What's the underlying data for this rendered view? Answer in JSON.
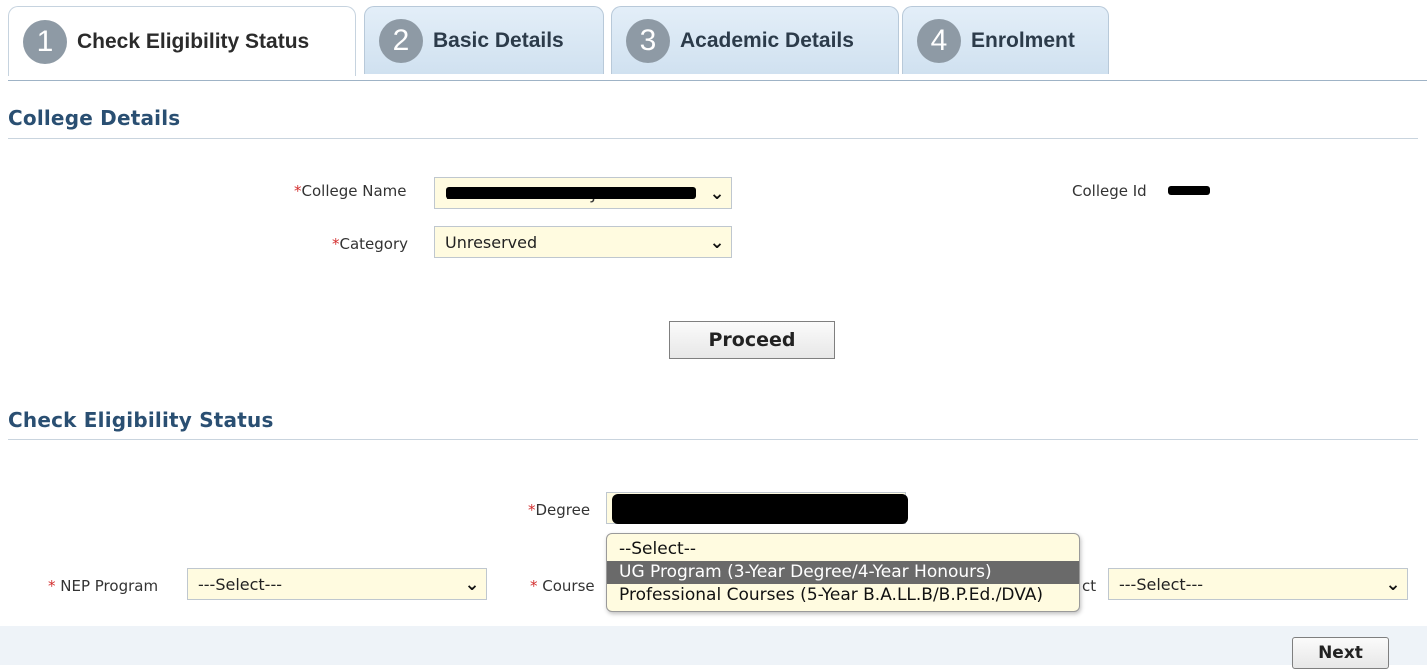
{
  "tabs": [
    {
      "num": "1",
      "label": "Check Eligibility Status"
    },
    {
      "num": "2",
      "label": "Basic Details"
    },
    {
      "num": "3",
      "label": "Academic Details"
    },
    {
      "num": "4",
      "label": "Enrolment"
    }
  ],
  "college_section": {
    "title": "College Details",
    "college_name_label": "College Name",
    "college_name_value": "101-BURDWAN RAJ COLLEGE",
    "category_label": "Category",
    "category_value": "Unreserved",
    "college_id_label": "College Id",
    "proceed_label": "Proceed"
  },
  "eligibility_section": {
    "title": "Check Eligibility Status",
    "degree_label": "Degree",
    "nep_label": " NEP Program",
    "nep_value": "---Select---",
    "course_label": " Course",
    "subject_label_tail": "ct",
    "subject_value": "---Select---",
    "next_label": "Next"
  },
  "degree_dropdown": {
    "options": [
      "--Select--",
      "UG Program (3-Year Degree/4-Year Honours)",
      "Professional Courses (5-Year B.A.LL.B/B.P.Ed./DVA)"
    ],
    "highlighted_index": 1
  },
  "colors": {
    "section_title": "#2a4f72",
    "required_asterisk": "#d32f2f",
    "select_background": "#fffbe0",
    "tab_background": "#d0e1f0",
    "highlighted_option": "#6a6a6a"
  },
  "icons": [
    "chevron-down-icon",
    "step-number-badge"
  ]
}
